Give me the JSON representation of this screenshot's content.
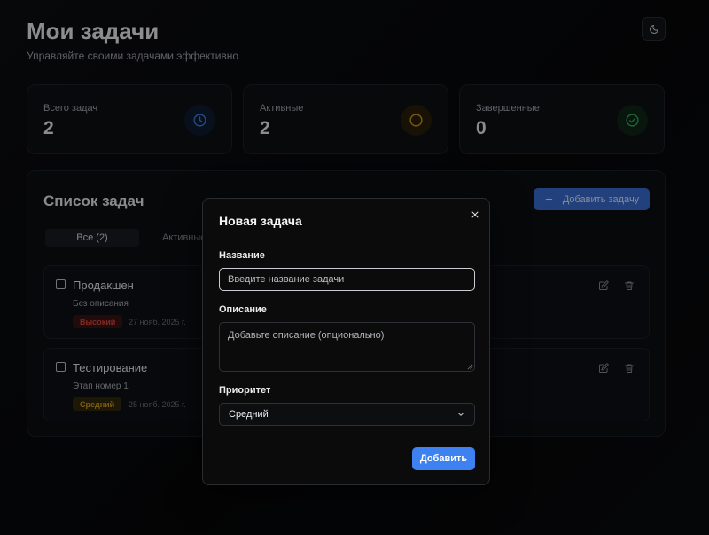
{
  "header": {
    "title": "Мои задачи",
    "subtitle": "Управляйте своими задачами эффективно",
    "theme_icon": "moon-icon"
  },
  "stats": [
    {
      "label": "Всего задач",
      "value": "2",
      "icon": "clock-icon",
      "color": "#3f7fe0"
    },
    {
      "label": "Активные",
      "value": "2",
      "icon": "circle-icon",
      "color": "#d69a1c"
    },
    {
      "label": "Завершенные",
      "value": "0",
      "icon": "check-circle-icon",
      "color": "#2fae5e"
    }
  ],
  "tasks_panel": {
    "title": "Список задач",
    "add_button_label": "Добавить задачу",
    "filters": [
      {
        "label": "Все (2)",
        "active": true
      },
      {
        "label": "Активные",
        "active": false
      }
    ],
    "tasks": [
      {
        "name": "Продакшен",
        "description": "Без описания",
        "priority": "Высокий",
        "priority_color": "#e0473f",
        "date": "27 нояб. 2025 г."
      },
      {
        "name": "Тестирование",
        "description": "Этап номер 1",
        "priority": "Средний",
        "priority_color": "#d8a31f",
        "date": "25 нояб. 2025 г."
      }
    ]
  },
  "modal": {
    "title": "Новая задача",
    "name_label": "Название",
    "name_placeholder": "Введите название задачи",
    "description_label": "Описание",
    "description_placeholder": "Добавьте описание (опционально)",
    "priority_label": "Приоритет",
    "priority_value": "Средний",
    "submit_label": "Добавить"
  },
  "colors": {
    "accent": "#3d82f0",
    "background": "#07080a"
  }
}
